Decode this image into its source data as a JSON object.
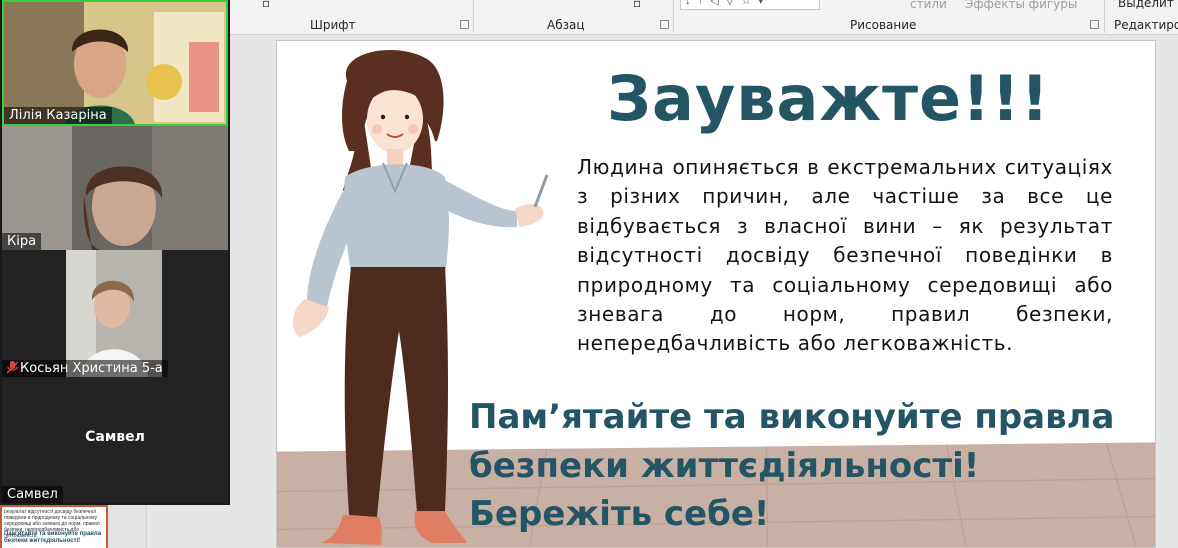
{
  "ribbon": {
    "groups": [
      "Шрифт",
      "Абзац",
      "Рисование",
      "Редактирова"
    ],
    "faded_items": [
      "стили",
      "Эффекты фигуры"
    ],
    "right_button": "Выделит"
  },
  "participants": [
    {
      "name": "Лілія Казаріна",
      "active_speaker": true
    },
    {
      "name": "Кіра"
    },
    {
      "name": "Косьян Христина 5-а",
      "muted": true
    },
    {
      "name": "Самвел",
      "display_name": "Самвел",
      "video_off": true
    }
  ],
  "slide": {
    "title": "Зауважте!!!",
    "body": "Людина опиняється в екстремальних ситуаціях з різних причин, але частіше за все це відбувається з власної вини – як результат відсутності досвіду безпечної поведінки в природному та соціальному середовищі або зневага до норм, правил безпеки, непередбачливість або легковажність.",
    "callout": [
      "Пам’ятайте та виконуйте правла",
      "безпеки життєдіяльності!",
      "Бережіть себе!"
    ]
  },
  "thumbnail": {
    "text": "результат відсутності досвіду безпечної поведінки в природному та соціальному середовищі або зневага до норм, правил безпеки, непередбачливість або легковажність.",
    "title": "Пам’ятайте та виконуйте правла безпеки життєдіяльності!"
  },
  "colors": {
    "title": "#245565",
    "floor": "#c9b0a5",
    "active_speaker_border": "#3ccd3c",
    "shirt": "#b8c4cf",
    "trousers": "#4f2a1e",
    "hair": "#5a2f1f"
  }
}
